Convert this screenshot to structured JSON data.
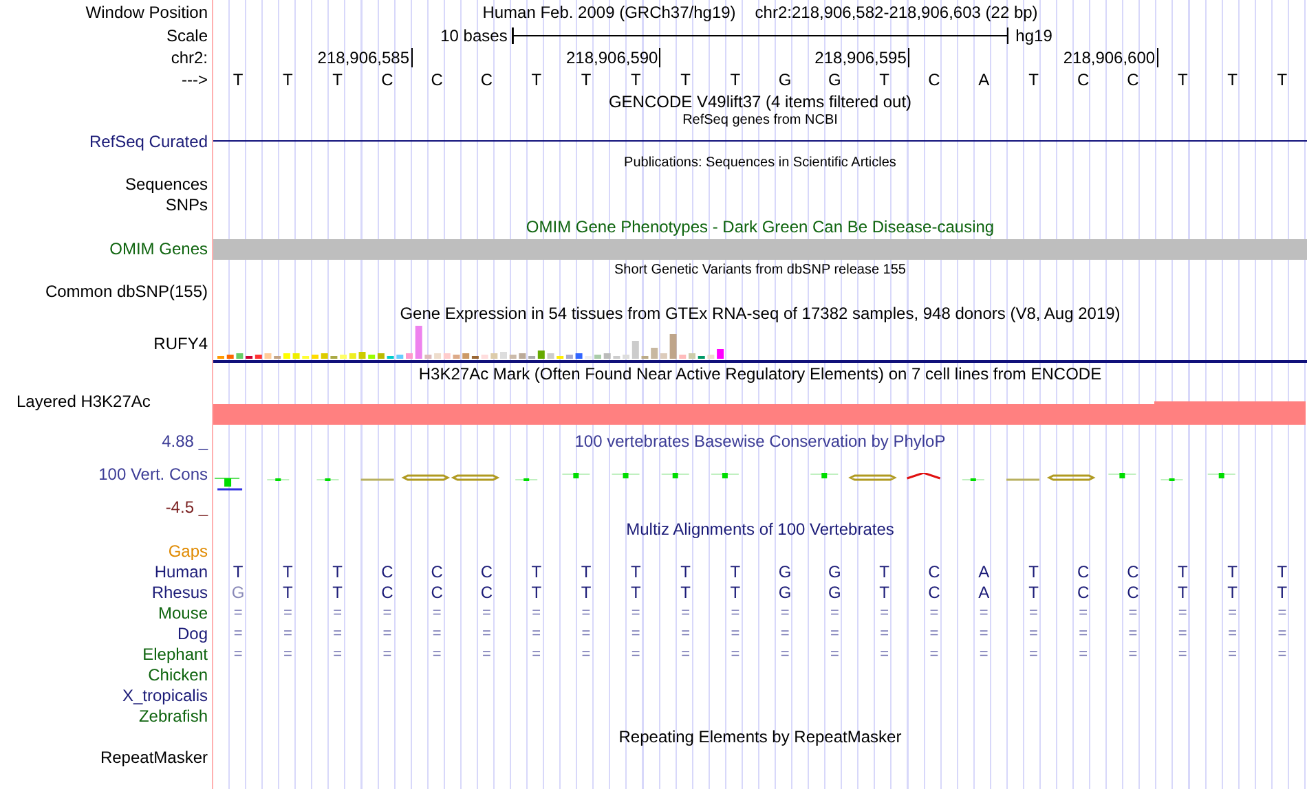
{
  "position": {
    "label": "Window Position",
    "assembly": "Human Feb. 2009 (GRCh37/hg19)",
    "range": "chr2:218,906,582-218,906,603 (22 bp)"
  },
  "scale": {
    "label": "Scale",
    "text": "10 bases",
    "db": "hg19"
  },
  "ruler": {
    "label": "chr2:",
    "ticks": [
      "218,906,585",
      "218,906,590",
      "218,906,595",
      "218,906,600"
    ]
  },
  "sequence": {
    "label": "--->",
    "bases": [
      "T",
      "T",
      "T",
      "C",
      "C",
      "C",
      "T",
      "T",
      "T",
      "T",
      "T",
      "G",
      "G",
      "T",
      "C",
      "A",
      "T",
      "C",
      "C",
      "T",
      "T",
      "T"
    ]
  },
  "gencode": {
    "title": "GENCODE V49lift37 (4 items filtered out)"
  },
  "refseq": {
    "title": "RefSeq genes from NCBI",
    "label": "RefSeq Curated"
  },
  "publications": {
    "title": "Publications: Sequences in Scientific Articles",
    "labels": [
      "Sequences",
      "SNPs"
    ]
  },
  "omim": {
    "title": "OMIM Gene Phenotypes - Dark Green Can Be Disease-causing",
    "label": "OMIM Genes"
  },
  "dbsnp": {
    "title": "Short Genetic Variants from dbSNP release 155",
    "label": "Common dbSNP(155)"
  },
  "gtex": {
    "title": "Gene Expression in 54 tissues from GTEx RNA-seq of 17382 samples, 948 donors (V8, Aug 2019)",
    "label": "RUFY4"
  },
  "h3k27ac": {
    "title": "H3K27Ac Mark (Often Found Near Active Regulatory Elements) on 7 cell lines from ENCODE",
    "label": "Layered H3K27Ac"
  },
  "phylop": {
    "title": "100 vertebrates Basewise Conservation by PhyloP",
    "max": "4.88 _",
    "label": "100 Vert. Cons",
    "min": "-4.5 _"
  },
  "multiz": {
    "title": "Multiz Alignments of 100 Vertebrates",
    "species": [
      {
        "name": "Gaps",
        "color": "#e08a00"
      },
      {
        "name": "Human",
        "color": "#1c1c78",
        "bases": [
          "T",
          "T",
          "T",
          "C",
          "C",
          "C",
          "T",
          "T",
          "T",
          "T",
          "T",
          "G",
          "G",
          "T",
          "C",
          "A",
          "T",
          "C",
          "C",
          "T",
          "T",
          "T"
        ]
      },
      {
        "name": "Rhesus",
        "color": "#1c1c78",
        "bases": [
          {
            "text": "G",
            "differs": true
          },
          {
            "text": "T",
            "differs": false
          },
          {
            "text": "T",
            "differs": false
          },
          {
            "text": "C",
            "differs": false
          },
          {
            "text": "C",
            "differs": false
          },
          {
            "text": "C",
            "differs": false
          },
          {
            "text": "T",
            "differs": false
          },
          {
            "text": "T",
            "differs": false
          },
          {
            "text": "T",
            "differs": false
          },
          {
            "text": "T",
            "differs": false
          },
          {
            "text": "T",
            "differs": false
          },
          {
            "text": "G",
            "differs": false
          },
          {
            "text": "G",
            "differs": false
          },
          {
            "text": "T",
            "differs": false
          },
          {
            "text": "C",
            "differs": false
          },
          {
            "text": "A",
            "differs": false
          },
          {
            "text": "T",
            "differs": false
          },
          {
            "text": "C",
            "differs": false
          },
          {
            "text": "C",
            "differs": false
          },
          {
            "text": "T",
            "differs": false
          },
          {
            "text": "T",
            "differs": false
          },
          {
            "text": "T",
            "differs": false
          }
        ]
      },
      {
        "name": "Mouse",
        "color": "#0e640e",
        "bases": [
          "=",
          "=",
          "=",
          "=",
          "=",
          "=",
          "=",
          "=",
          "=",
          "=",
          "=",
          "=",
          "=",
          "=",
          "=",
          "=",
          "=",
          "=",
          "=",
          "=",
          "=",
          "="
        ]
      },
      {
        "name": "Dog",
        "color": "#1c1c78",
        "bases": [
          "=",
          "=",
          "=",
          "=",
          "=",
          "=",
          "=",
          "=",
          "=",
          "=",
          "=",
          "=",
          "=",
          "=",
          "=",
          "=",
          "=",
          "=",
          "=",
          "=",
          "=",
          "="
        ]
      },
      {
        "name": "Elephant",
        "color": "#0e640e",
        "bases": [
          "=",
          "=",
          "=",
          "=",
          "=",
          "=",
          "=",
          "=",
          "=",
          "=",
          "=",
          "=",
          "=",
          "=",
          "=",
          "=",
          "=",
          "=",
          "=",
          "=",
          "=",
          "="
        ]
      },
      {
        "name": "Chicken",
        "color": "#0e640e"
      },
      {
        "name": "X_tropicalis",
        "color": "#1c1c78"
      },
      {
        "name": "Zebrafish",
        "color": "#0e640e"
      }
    ]
  },
  "repeatmasker": {
    "title": "Repeating Elements by RepeatMasker",
    "label": "RepeatMasker"
  }
}
